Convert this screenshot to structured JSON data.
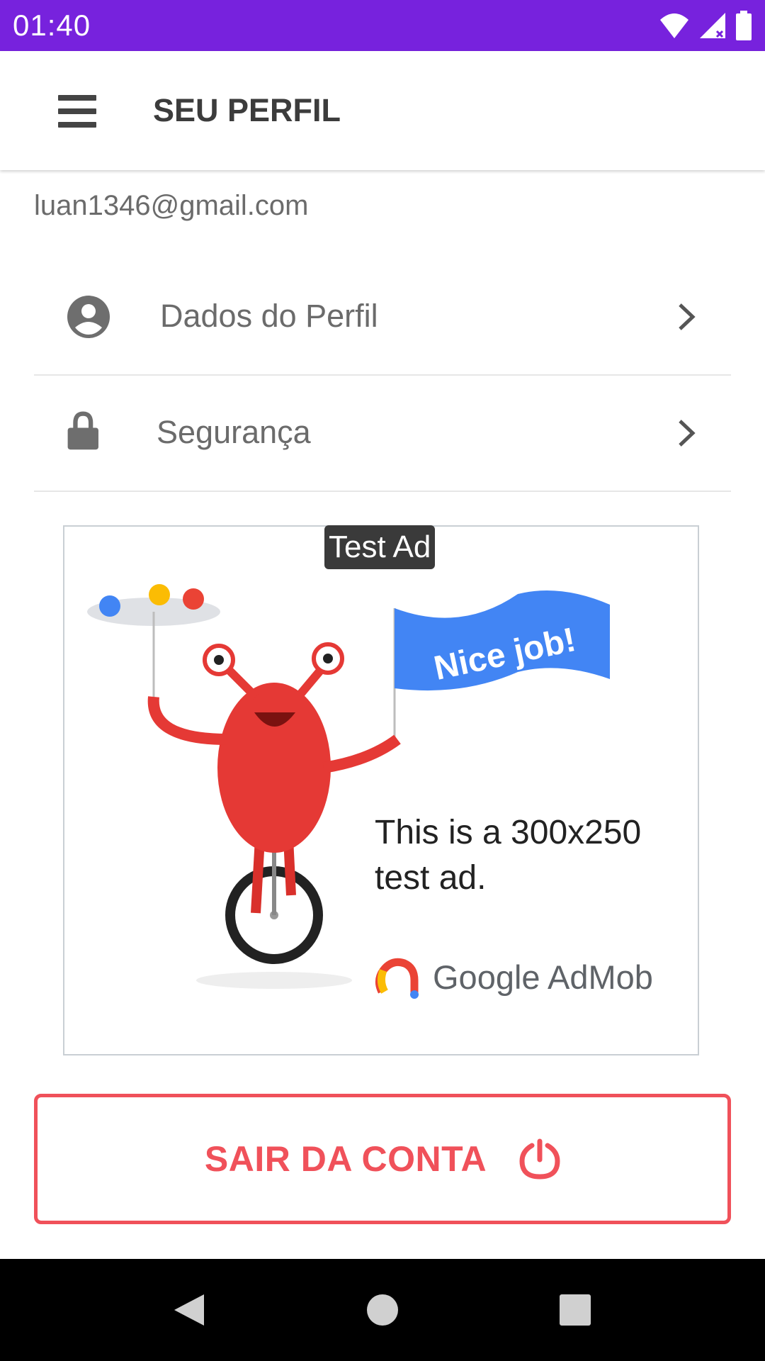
{
  "status_bar": {
    "time": "01:40",
    "icons": [
      "wifi-icon",
      "signal-icon",
      "battery-icon"
    ],
    "background": "#7722dd"
  },
  "app_bar": {
    "menu_icon": "menu-icon",
    "title": "SEU PERFIL"
  },
  "profile": {
    "email": "luan1346@gmail.com"
  },
  "menu": {
    "items": [
      {
        "label": "Dados do Perfil",
        "icon": "account-circle-icon"
      },
      {
        "label": "Segurança",
        "icon": "lock-icon"
      }
    ],
    "chevron_icon": "chevron-right-icon"
  },
  "ad": {
    "badge": "Test Ad",
    "flag_text": "Nice job!",
    "text_line1": "This is a 300x250",
    "text_line2": "test ad.",
    "brand": "Google AdMob"
  },
  "logout": {
    "label": "SAIR DA CONTA",
    "icon": "power-icon",
    "color": "#f0515a"
  },
  "nav_bar": {
    "icons": [
      "back-icon",
      "home-icon",
      "recents-icon"
    ]
  }
}
